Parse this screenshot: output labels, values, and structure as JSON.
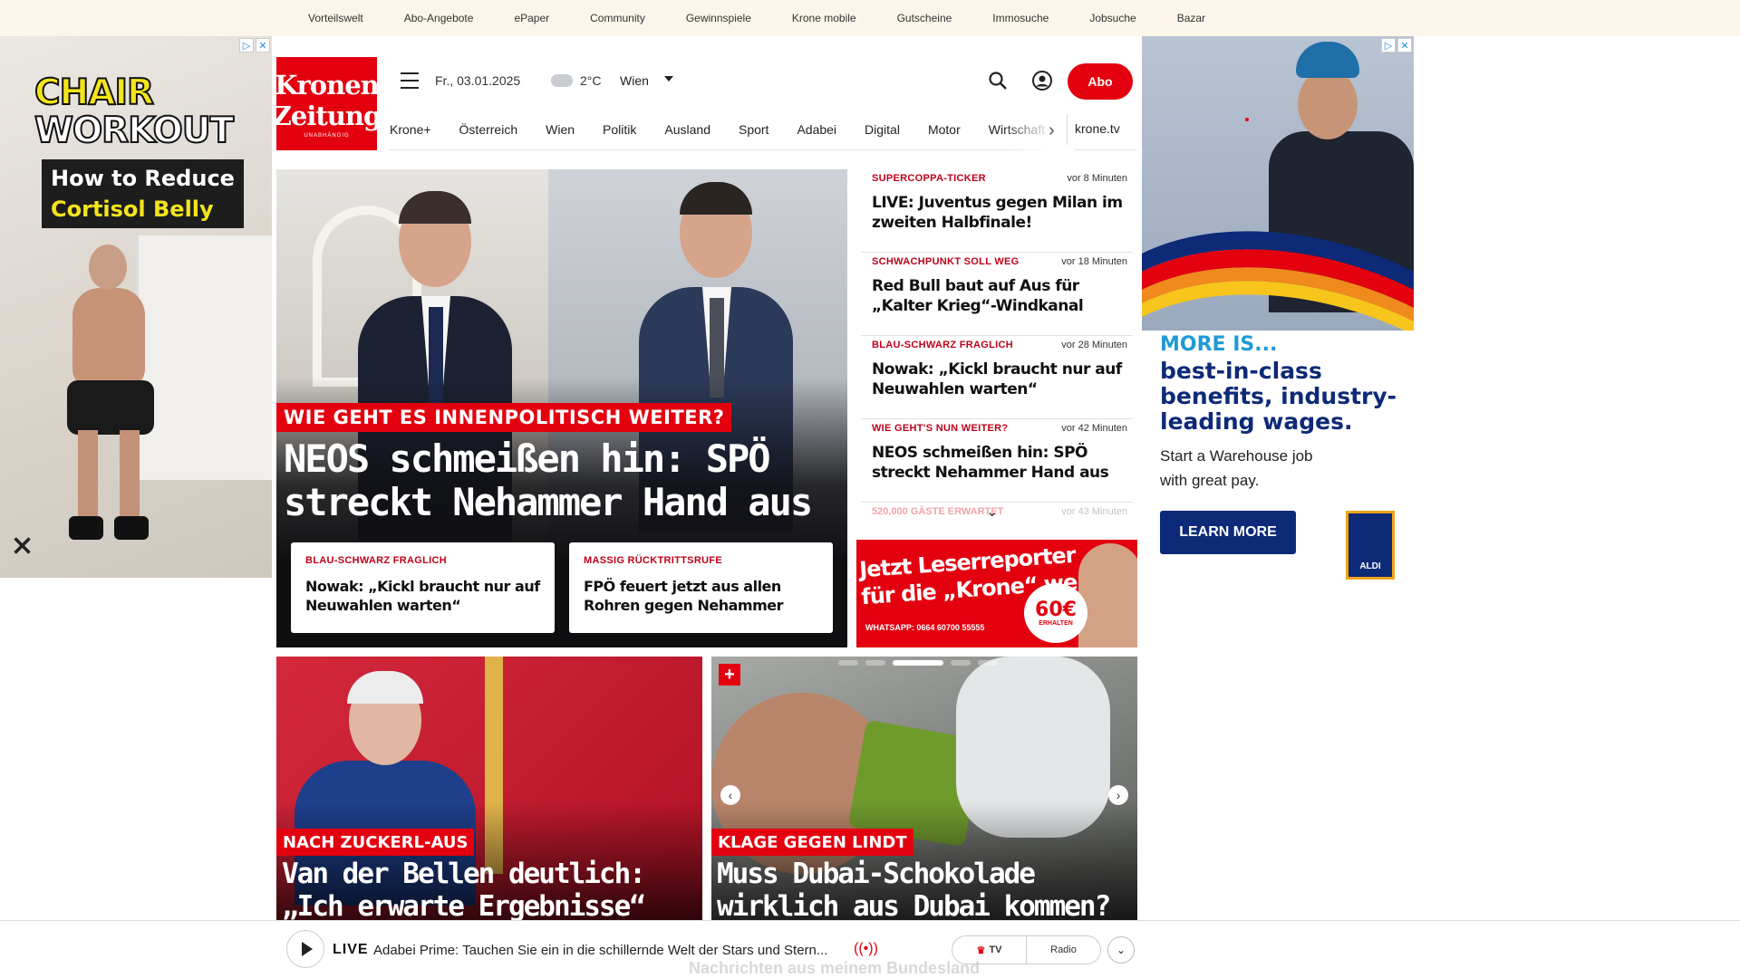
{
  "topbar": {
    "links": [
      "Vorteilswelt",
      "Abo-Angebote",
      "ePaper",
      "Community",
      "Gewinnspiele",
      "Krone mobile",
      "Gutscheine",
      "Immosuche",
      "Jobsuche",
      "Bazar"
    ]
  },
  "ad_left": {
    "line1": "CHAIR",
    "line2": "WORKOUT",
    "box1": "How to Reduce",
    "box2": "Cortisol Belly"
  },
  "ad_right": {
    "more": "MORE IS...",
    "headline": "best-in-class benefits, industry-leading wages.",
    "sub": "Start a Warehouse job with great pay.",
    "cta": "LEARN MORE",
    "brand": "ALDI"
  },
  "header": {
    "logo_line1": "Kronen",
    "logo_line2": "Zeitung",
    "logo_line3": "UNABHÄNGIG",
    "date": "Fr., 03.01.2025",
    "temperature": "2°C",
    "city": "Wien",
    "abo_label": "Abo"
  },
  "nav": {
    "items": [
      "Krone+",
      "Österreich",
      "Wien",
      "Politik",
      "Ausland",
      "Sport",
      "Adabei",
      "Digital",
      "Motor",
      "Wirtschaft"
    ],
    "tv": "krone.tv"
  },
  "hero": {
    "kicker": "WIE GEHT ES INNENPOLITISCH WEITER?",
    "title": "NEOS schmeißen hin: SPÖ streckt Nehammer Hand aus",
    "cards": [
      {
        "kicker": "BLAU-SCHWARZ FRAGLICH",
        "title": "Nowak: „Kickl braucht nur auf Neuwahlen warten“"
      },
      {
        "kicker": "MASSIG RÜCKTRITTSRUFE",
        "title": "FPÖ feuert jetzt aus allen Rohren gegen Nehammer"
      }
    ]
  },
  "ticker": {
    "items": [
      {
        "kicker": "SUPERCOPPA-TICKER",
        "time": "vor 8 Minuten",
        "title": "LIVE: Juventus gegen Milan im zweiten Halbfinale!"
      },
      {
        "kicker": "SCHWACHPUNKT SOLL WEG",
        "time": "vor 18 Minuten",
        "title": "Red Bull baut auf Aus für „Kalter Krieg“-Windkanal"
      },
      {
        "kicker": "BLAU-SCHWARZ FRAGLICH",
        "time": "vor 28 Minuten",
        "title": "Nowak: „Kickl braucht nur auf Neuwahlen warten“"
      },
      {
        "kicker": "WIE GEHT'S NUN WEITER?",
        "time": "vor 42 Minuten",
        "title": "NEOS schmeißen hin: SPÖ streckt Nehammer Hand aus"
      }
    ],
    "faded": {
      "kicker": "520.000 GÄSTE ERWARTET",
      "time": "vor 43 Minuten"
    }
  },
  "leserreporter": {
    "line1": "Jetzt Leserreporter",
    "line2": "für die „Krone“ werden",
    "whatsapp": "WHATSAPP: 0664 60700 55555",
    "amount": "60€",
    "amount_sub": "ERHALTEN"
  },
  "stories": [
    {
      "kicker": "NACH ZUCKERL-AUS",
      "title": "Van der Bellen deutlich: „Ich erwarte Ergebnisse“"
    },
    {
      "kicker": "KLAGE GEGEN LINDT",
      "title": "Muss Dubai-Schokolade wirklich aus Dubai kommen?"
    }
  ],
  "player": {
    "live": "LIVE",
    "description": "Adabei Prime: Tauchen Sie ein in die schillernde Welt der Stars und Stern...",
    "tv": "TV",
    "radio": "Radio",
    "behind_text": "Nachrichten aus meinem Bundesland"
  }
}
